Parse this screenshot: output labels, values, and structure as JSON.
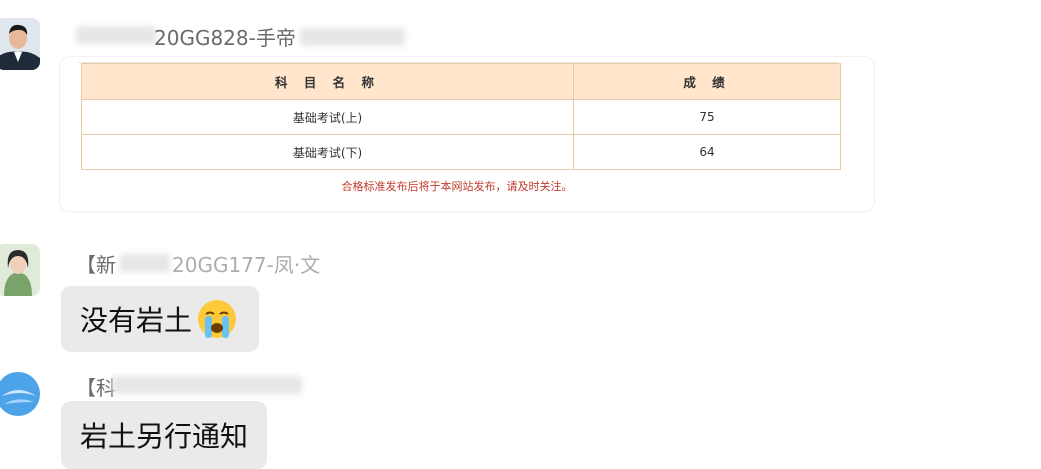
{
  "messages": [
    {
      "sender_visible": "20GG828-手帝",
      "card": {
        "table": {
          "headers": [
            "科 目 名 称",
            "成 绩"
          ],
          "rows": [
            [
              "基础考试(上)",
              "75"
            ],
            [
              "基础考试(下)",
              "64"
            ]
          ]
        },
        "notice": "合格标准发布后将于本网站发布，请及时关注。"
      }
    },
    {
      "sender_visible": "【新",
      "sender_visible_2": "20GG177-凤·文",
      "text": "没有岩土",
      "emoji": "crying-face-emoji"
    },
    {
      "sender_visible": "【科",
      "text": "岩土另行通知"
    }
  ],
  "colors": {
    "table_header_bg": "#ffe6cc",
    "table_border": "#e8c9a8",
    "notice_red": "#c0392b",
    "bubble_bg": "#eaeaea"
  }
}
